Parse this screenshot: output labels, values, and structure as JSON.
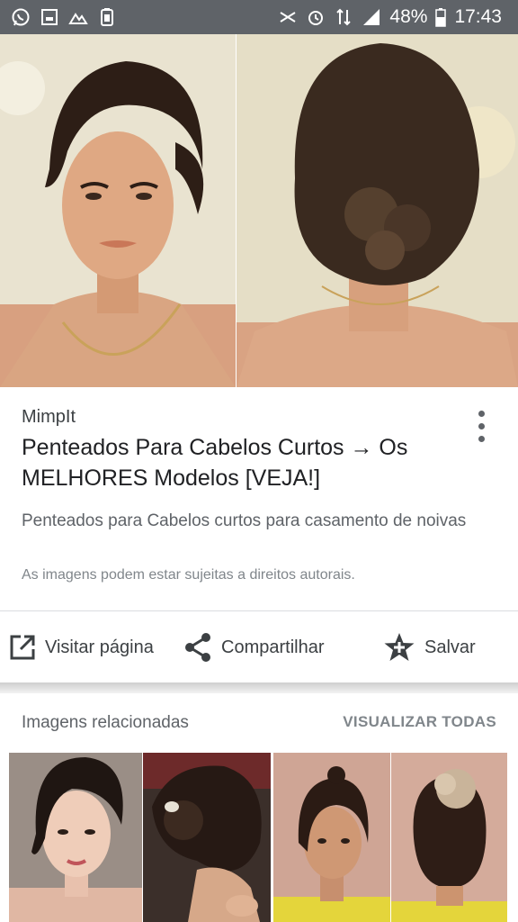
{
  "status_bar": {
    "battery": "48%",
    "time": "17:43"
  },
  "result": {
    "source": "MimpIt",
    "title": "Penteados Para Cabelos Curtos → Os MELHORES Modelos [VEJA!]",
    "description": "Penteados para Cabelos curtos para casamento de noivas",
    "copyright_note": "As imagens podem estar sujeitas a direitos autorais."
  },
  "actions": {
    "visit": "Visitar página",
    "share": "Compartilhar",
    "save": "Salvar"
  },
  "related": {
    "title": "Imagens relacionadas",
    "view_all": "VISUALIZAR TODAS"
  },
  "colors": {
    "status_bar": "#5f6368",
    "text_primary": "#202124",
    "text_secondary": "#5f6368",
    "icon": "#3c4043"
  }
}
